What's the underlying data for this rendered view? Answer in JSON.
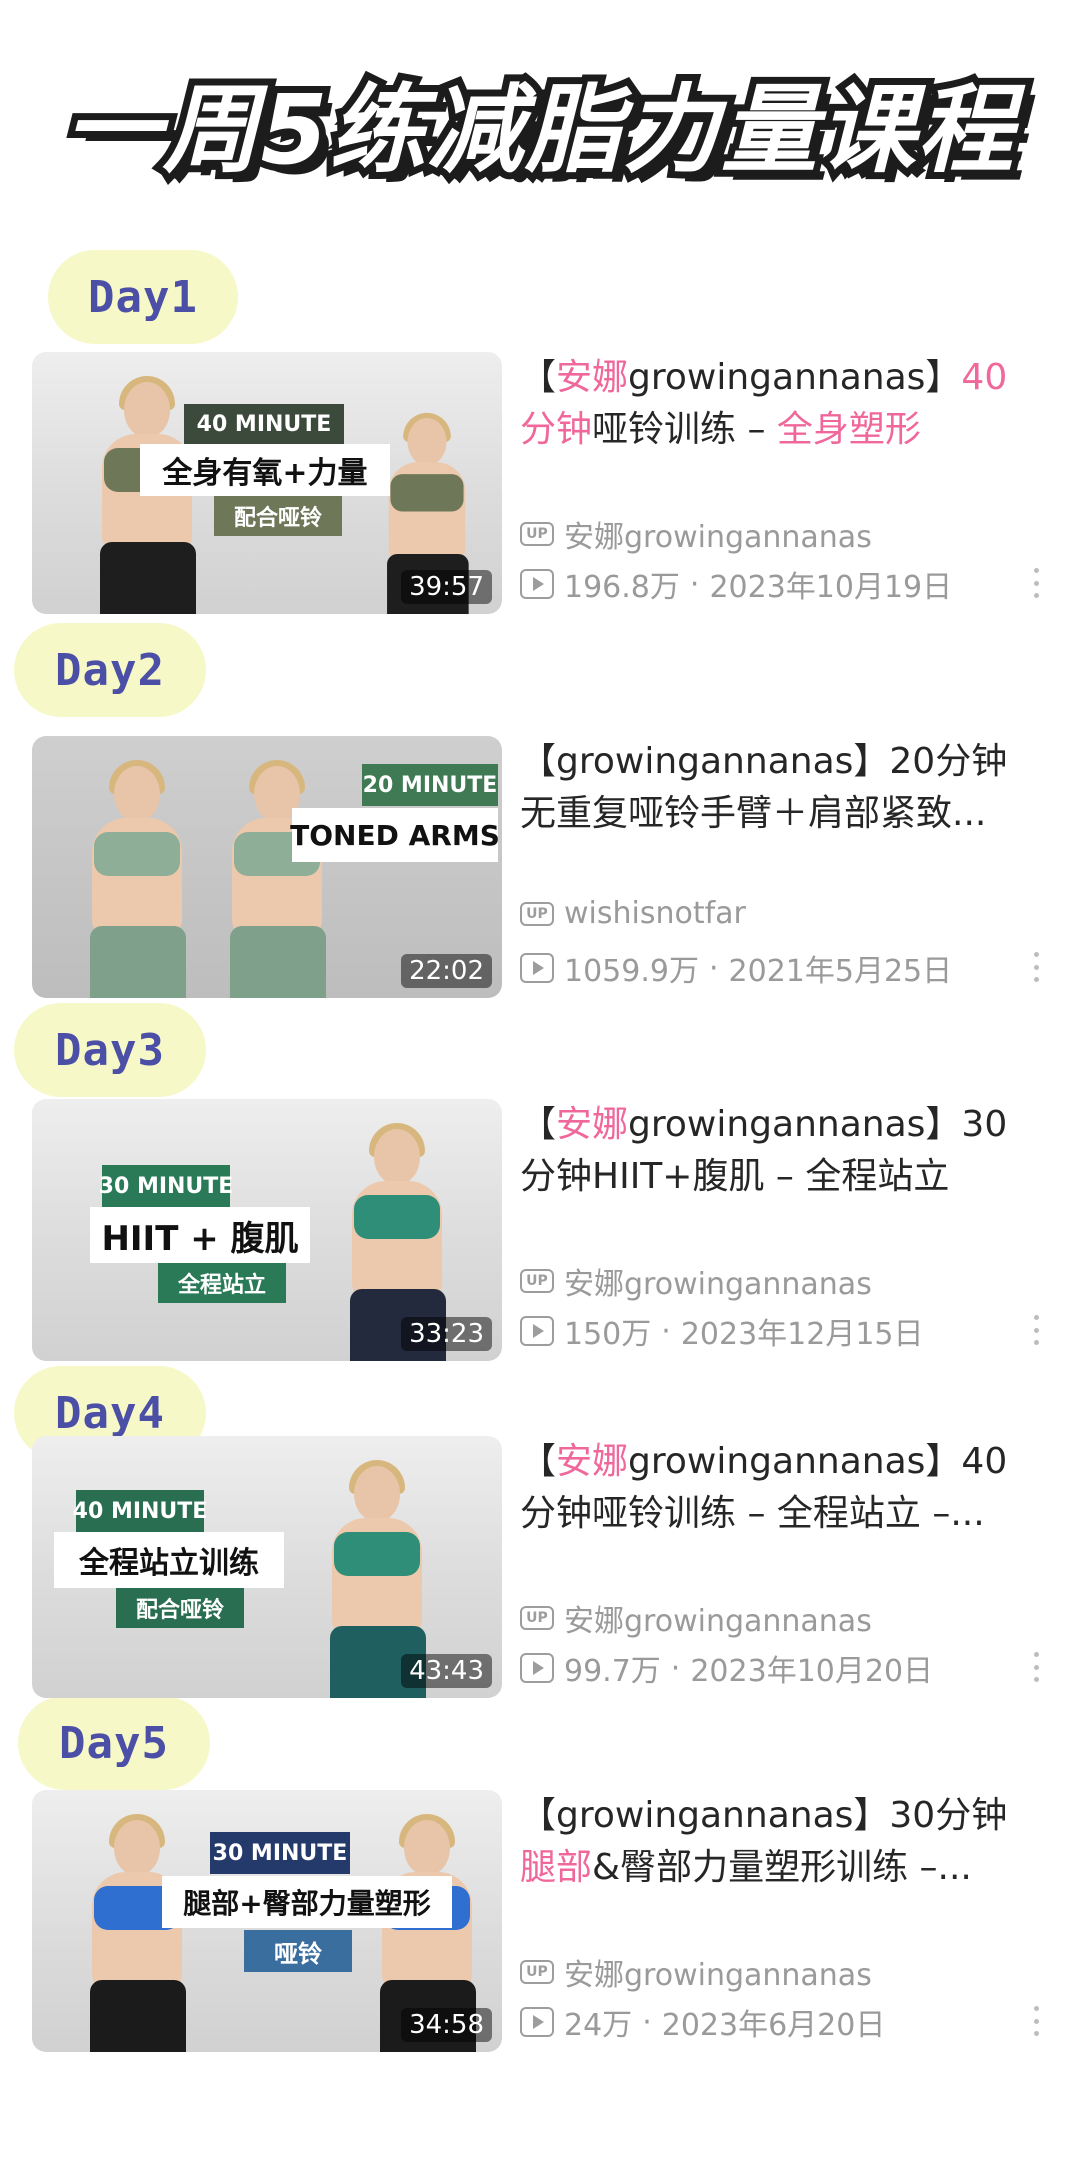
{
  "page_title": "一周5练减脂力量课程",
  "colors": {
    "highlight": "#f0689b",
    "day_badge_bg": "#f7f8c8",
    "day_badge_text": "#4b4fa6",
    "meta_gray": "#9a9a9a"
  },
  "days": [
    {
      "badge": "Day1",
      "video": {
        "title_parts": [
          {
            "text": "【",
            "hl": false
          },
          {
            "text": "安娜",
            "hl": true
          },
          {
            "text": "growingannanas】",
            "hl": false
          },
          {
            "text": "40分钟",
            "hl": true
          },
          {
            "text": "哑铃训练 – ",
            "hl": false
          },
          {
            "text": "全身塑形",
            "hl": true
          }
        ],
        "uploader_icon": "up-badge-icon",
        "uploader": "安娜growingannanas",
        "views": "196.8万",
        "date": "2023年10月19日",
        "duration": "39:57",
        "thumb_text": {
          "minute": "40 MINUTE",
          "main": "全身有氧+力量",
          "sub": "配合哑铃"
        }
      }
    },
    {
      "badge": "Day2",
      "video": {
        "title_parts": [
          {
            "text": "【growingannanas】20分钟无重复哑铃手臂＋肩部紧致...",
            "hl": false
          }
        ],
        "uploader_icon": "up-badge-icon",
        "uploader": "wishisnotfar",
        "views": "1059.9万",
        "date": "2021年5月25日",
        "duration": "22:02",
        "thumb_text": {
          "minute": "20 MINUTE",
          "main": "TONED ARMS",
          "sub": ""
        }
      }
    },
    {
      "badge": "Day3",
      "video": {
        "title_parts": [
          {
            "text": "【",
            "hl": false
          },
          {
            "text": "安娜",
            "hl": true
          },
          {
            "text": "growingannanas】30分钟HIIT+腹肌 – 全程站立",
            "hl": false
          }
        ],
        "uploader_icon": "up-badge-icon",
        "uploader": "安娜growingannanas",
        "views": "150万",
        "date": "2023年12月15日",
        "duration": "33:23",
        "thumb_text": {
          "minute": "30 MINUTE",
          "main": "HIIT + 腹肌",
          "sub": "全程站立"
        }
      }
    },
    {
      "badge": "Day4",
      "video": {
        "title_parts": [
          {
            "text": "【",
            "hl": false
          },
          {
            "text": "安娜",
            "hl": true
          },
          {
            "text": "growingannanas】40分钟哑铃训练 – 全程站立 –...",
            "hl": false
          }
        ],
        "uploader_icon": "up-badge-icon",
        "uploader": "安娜growingannanas",
        "views": "99.7万",
        "date": "2023年10月20日",
        "duration": "43:43",
        "thumb_text": {
          "minute": "40 MINUTE",
          "main": "全程站立训练",
          "sub": "配合哑铃"
        }
      }
    },
    {
      "badge": "Day5",
      "video": {
        "title_parts": [
          {
            "text": "【growingannanas】30分钟",
            "hl": false
          },
          {
            "text": "腿部",
            "hl": true
          },
          {
            "text": "&臀部力量塑形训练 –...",
            "hl": false
          }
        ],
        "uploader_icon": "up-badge-icon",
        "uploader": "安娜growingannanas",
        "views": "24万",
        "date": "2023年6月20日",
        "duration": "34:58",
        "thumb_text": {
          "minute": "30 MINUTE",
          "main": "腿部+臀部力量塑形",
          "sub": "哑铃"
        }
      }
    }
  ]
}
